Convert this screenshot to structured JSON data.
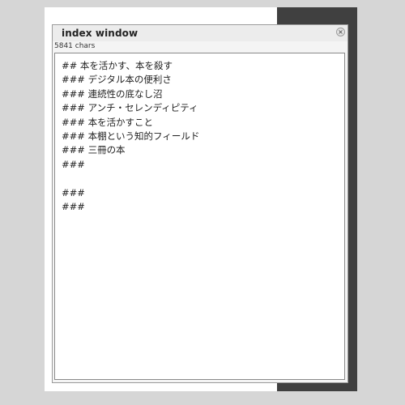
{
  "window": {
    "title": "index window",
    "char_count": "5841 chars",
    "close_icon": "close-icon",
    "close_glyph": "×"
  },
  "outline": {
    "lines": [
      "## 本を活かす、本を殺す",
      "### デジタル本の便利さ",
      "### 連続性の底なし沼",
      "### アンチ・セレンディピティ",
      "### 本を活かすこと",
      "### 本棚という知的フィールド",
      "### 三冊の本",
      "###",
      "",
      "###",
      "###"
    ]
  },
  "colors": {
    "background": "#d6d6d6",
    "page": "#ffffff",
    "dark_panel": "#404040",
    "window_chrome": "#ececec",
    "text": "#222222"
  }
}
